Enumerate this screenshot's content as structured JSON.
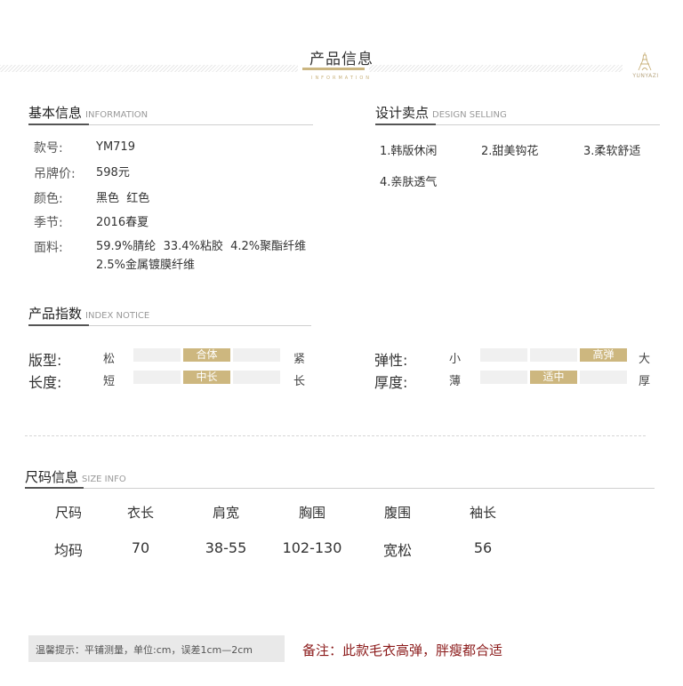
{
  "header": {
    "title": "产品信息",
    "subtitle": "INFORMATION",
    "brand": "YUNYAZI"
  },
  "basic": {
    "title": "基本信息",
    "subtitle": "INFORMATION",
    "rows": [
      {
        "label": "款号:",
        "value": "YM719"
      },
      {
        "label": "吊牌价:",
        "value": "598元"
      },
      {
        "label": "颜色:",
        "value": "黑色  红色"
      },
      {
        "label": "季节:",
        "value": "2016春夏"
      },
      {
        "label": "面料:",
        "value": "59.9%腈纶  33.4%粘胶  4.2%聚酯纤维",
        "value2": "2.5%金属镀膜纤维"
      }
    ]
  },
  "design": {
    "title": "设计卖点",
    "subtitle": "DESIGN SELLING",
    "items": [
      "1.韩版休闲",
      "2.甜美钩花",
      "3.柔软舒适",
      "4.亲肤透气"
    ]
  },
  "index": {
    "title": "产品指数",
    "subtitle": "INDEX NOTICE",
    "rows": [
      {
        "label": "版型:",
        "low": "松",
        "high": "紧",
        "selected": "合体",
        "selected_index": 1
      },
      {
        "label": "长度:",
        "low": "短",
        "high": "长",
        "selected": "中长",
        "selected_index": 1
      },
      {
        "label": "弹性:",
        "low": "小",
        "high": "大",
        "selected": "高弹",
        "selected_index": 2
      },
      {
        "label": "厚度:",
        "low": "薄",
        "high": "厚",
        "selected": "适中",
        "selected_index": 1
      }
    ]
  },
  "size": {
    "title": "尺码信息",
    "subtitle": "SIZE INFO",
    "headers": [
      "尺码",
      "衣长",
      "肩宽",
      "胸围",
      "腹围",
      "袖长"
    ],
    "rows": [
      [
        "均码",
        "70",
        "38-55",
        "102-130",
        "宽松",
        "56"
      ]
    ]
  },
  "footer": {
    "tip": "温馨提示：平铺测量，单位:cm，误差1cm—2cm",
    "note": "备注：此款毛衣高弹，胖瘦都合适"
  },
  "colors": {
    "accent": "#cdb77f",
    "note": "#8b1a1a",
    "inactive_segment": "#f0f0f0"
  }
}
